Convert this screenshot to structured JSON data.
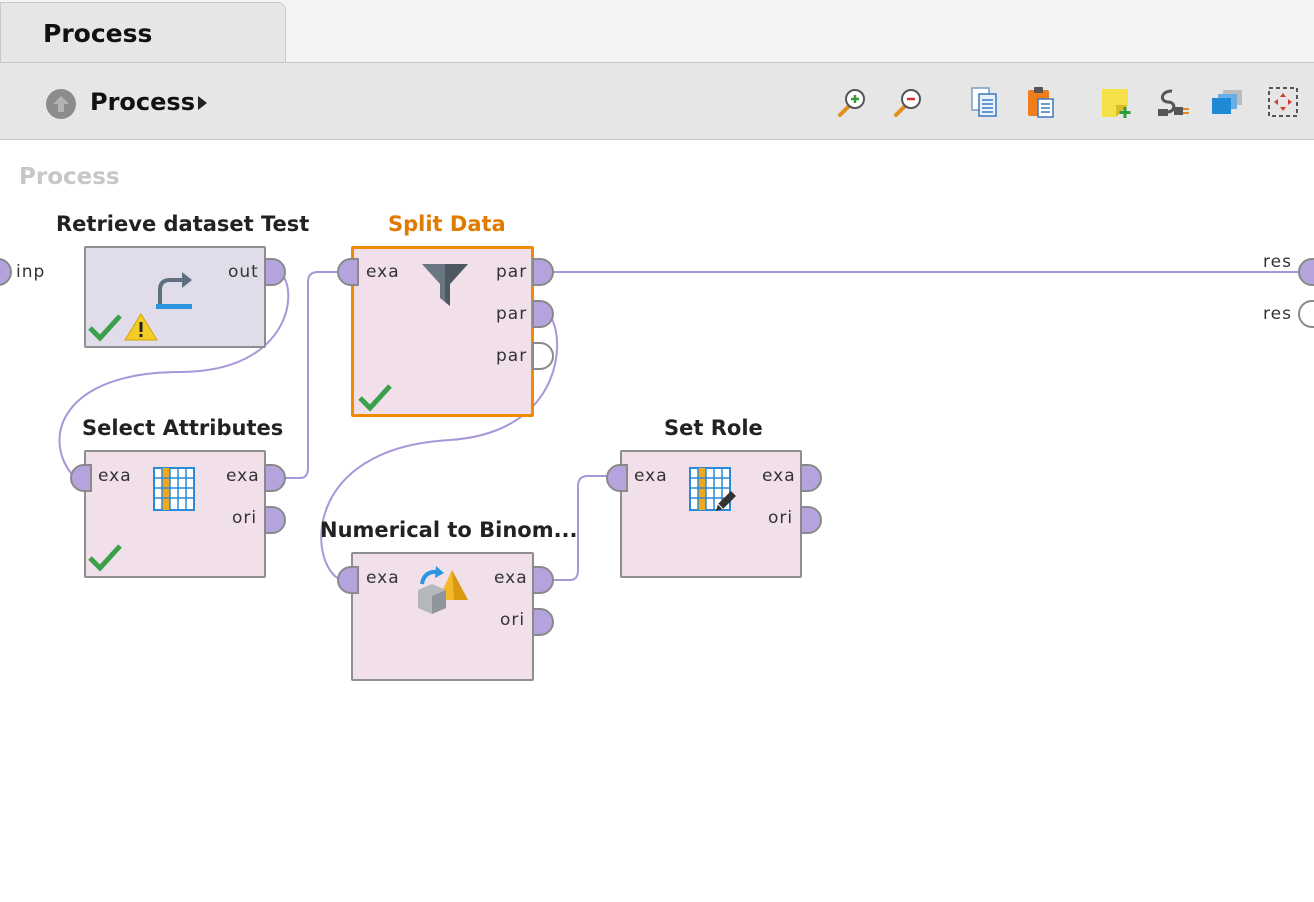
{
  "tab": {
    "label": "Process"
  },
  "breadcrumb": {
    "label": "Process"
  },
  "toolbar": {
    "icons": [
      "zoom-in-icon",
      "zoom-out-icon",
      "copy-icon",
      "paste-icon",
      "add-note-icon",
      "auto-wire-icon",
      "layers-icon",
      "fit-view-icon"
    ]
  },
  "canvas": {
    "title": "Process"
  },
  "process_ports": {
    "input": "inp",
    "output_1": "res",
    "output_2": "res"
  },
  "operators": {
    "retrieve": {
      "title": "Retrieve dataset Test",
      "out": "out",
      "status": [
        "check",
        "warning"
      ]
    },
    "split": {
      "title": "Split Data",
      "in": "exa",
      "out1": "par",
      "out2": "par",
      "out3": "par",
      "status": [
        "check"
      ]
    },
    "select": {
      "title": "Select Attributes",
      "in": "exa",
      "out1": "exa",
      "out2": "ori",
      "status": [
        "check"
      ]
    },
    "numerical": {
      "title": "Numerical to Binom...",
      "in": "exa",
      "out1": "exa",
      "out2": "ori"
    },
    "setrole": {
      "title": "Set Role",
      "in": "exa",
      "out1": "exa",
      "out2": "ori"
    }
  },
  "colors": {
    "selected_title": "#e07b00",
    "selected_border": "#f08a00",
    "retrieve_bg": "#e0dcea",
    "operator_bg": "#f1dfea",
    "wire": "#a996d9",
    "port": "#b5a3dd"
  }
}
